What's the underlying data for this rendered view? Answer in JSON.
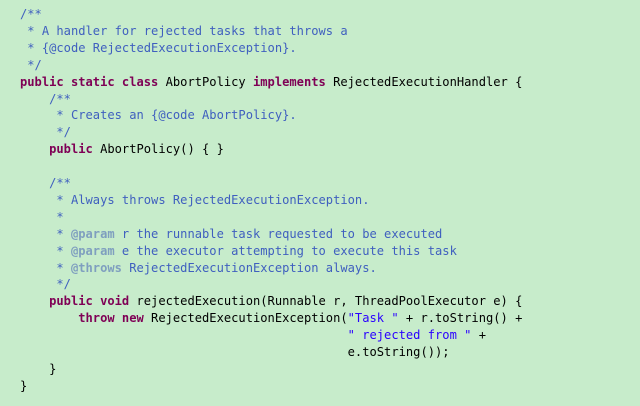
{
  "editor": {
    "background": "#c7eccb",
    "colors": {
      "comment": "#3f5fbf",
      "keyword": "#7f0055",
      "javadoc_tag": "#7f9fbf",
      "string": "#2a00ff",
      "plain": "#000000"
    },
    "lines": [
      [
        {
          "t": "comment",
          "v": "/**"
        }
      ],
      [
        {
          "t": "comment",
          "v": " * A handler for rejected tasks that throws a"
        }
      ],
      [
        {
          "t": "comment",
          "v": " * {@code RejectedExecutionException}."
        }
      ],
      [
        {
          "t": "comment",
          "v": " */"
        }
      ],
      [
        {
          "t": "kw",
          "v": "public static class"
        },
        {
          "t": "plain",
          "v": " AbortPolicy "
        },
        {
          "t": "kw",
          "v": "implements"
        },
        {
          "t": "plain",
          "v": " RejectedExecutionHandler {"
        }
      ],
      [
        {
          "t": "plain",
          "v": "    "
        },
        {
          "t": "comment",
          "v": "/**"
        }
      ],
      [
        {
          "t": "comment",
          "v": "     * Creates an {@code AbortPolicy}."
        }
      ],
      [
        {
          "t": "comment",
          "v": "     */"
        }
      ],
      [
        {
          "t": "plain",
          "v": "    "
        },
        {
          "t": "kw",
          "v": "public"
        },
        {
          "t": "plain",
          "v": " AbortPolicy() { }"
        }
      ],
      [
        {
          "t": "plain",
          "v": ""
        }
      ],
      [
        {
          "t": "plain",
          "v": "    "
        },
        {
          "t": "comment",
          "v": "/**"
        }
      ],
      [
        {
          "t": "comment",
          "v": "     * Always throws RejectedExecutionException."
        }
      ],
      [
        {
          "t": "comment",
          "v": "     *"
        }
      ],
      [
        {
          "t": "comment",
          "v": "     * "
        },
        {
          "t": "tag",
          "v": "@param"
        },
        {
          "t": "comment",
          "v": " r the runnable task requested to be executed"
        }
      ],
      [
        {
          "t": "comment",
          "v": "     * "
        },
        {
          "t": "tag",
          "v": "@param"
        },
        {
          "t": "comment",
          "v": " e the executor attempting to execute this task"
        }
      ],
      [
        {
          "t": "comment",
          "v": "     * "
        },
        {
          "t": "tag",
          "v": "@throws"
        },
        {
          "t": "comment",
          "v": " RejectedExecutionException always."
        }
      ],
      [
        {
          "t": "comment",
          "v": "     */"
        }
      ],
      [
        {
          "t": "plain",
          "v": "    "
        },
        {
          "t": "kw",
          "v": "public void"
        },
        {
          "t": "plain",
          "v": " rejectedExecution(Runnable r, ThreadPoolExecutor e) {"
        }
      ],
      [
        {
          "t": "plain",
          "v": "        "
        },
        {
          "t": "kw",
          "v": "throw new"
        },
        {
          "t": "plain",
          "v": " RejectedExecutionException("
        },
        {
          "t": "str",
          "v": "\"Task \""
        },
        {
          "t": "plain",
          "v": " + r.toString() +"
        }
      ],
      [
        {
          "t": "plain",
          "v": "                                             "
        },
        {
          "t": "str",
          "v": "\" rejected from \""
        },
        {
          "t": "plain",
          "v": " +"
        }
      ],
      [
        {
          "t": "plain",
          "v": "                                             e.toString());"
        }
      ],
      [
        {
          "t": "plain",
          "v": "    }"
        }
      ],
      [
        {
          "t": "plain",
          "v": "}"
        }
      ]
    ]
  }
}
